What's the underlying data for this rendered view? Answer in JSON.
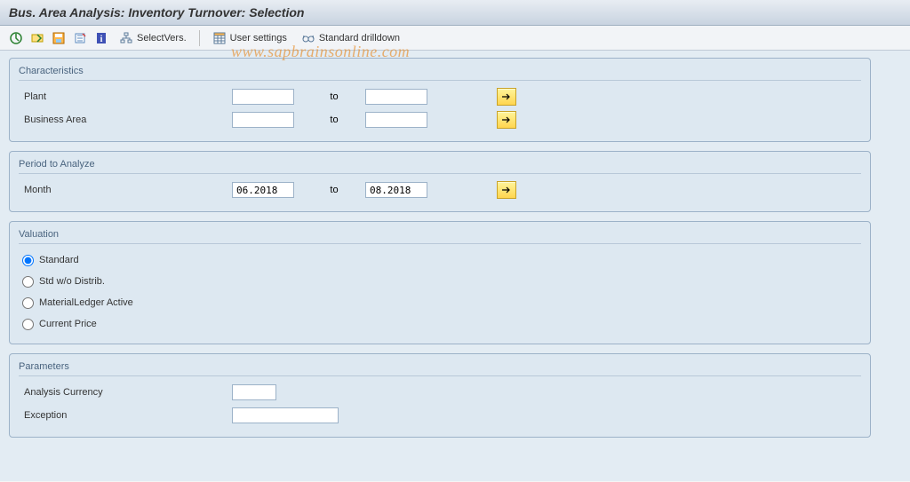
{
  "window": {
    "title": "Bus. Area Analysis: Inventory Turnover: Selection"
  },
  "toolbar": {
    "select_vers": "SelectVers.",
    "user_settings": "User settings",
    "standard_drilldown": "Standard drilldown"
  },
  "characteristics": {
    "title": "Characteristics",
    "plant_label": "Plant",
    "plant_from": "",
    "plant_to": "",
    "business_area_label": "Business Area",
    "business_area_from": "",
    "business_area_to": "",
    "to_label": "to"
  },
  "period": {
    "title": "Period to Analyze",
    "month_label": "Month",
    "month_from": "06.2018",
    "month_to": "08.2018",
    "to_label": "to"
  },
  "valuation": {
    "title": "Valuation",
    "standard": "Standard",
    "std_wo_distrib": "Std w/o Distrib.",
    "material_ledger_active": "MaterialLedger Active",
    "current_price": "Current Price"
  },
  "parameters": {
    "title": "Parameters",
    "analysis_currency_label": "Analysis Currency",
    "analysis_currency_value": "",
    "exception_label": "Exception",
    "exception_value": ""
  },
  "watermark": "www.sapbrainsonline.com"
}
